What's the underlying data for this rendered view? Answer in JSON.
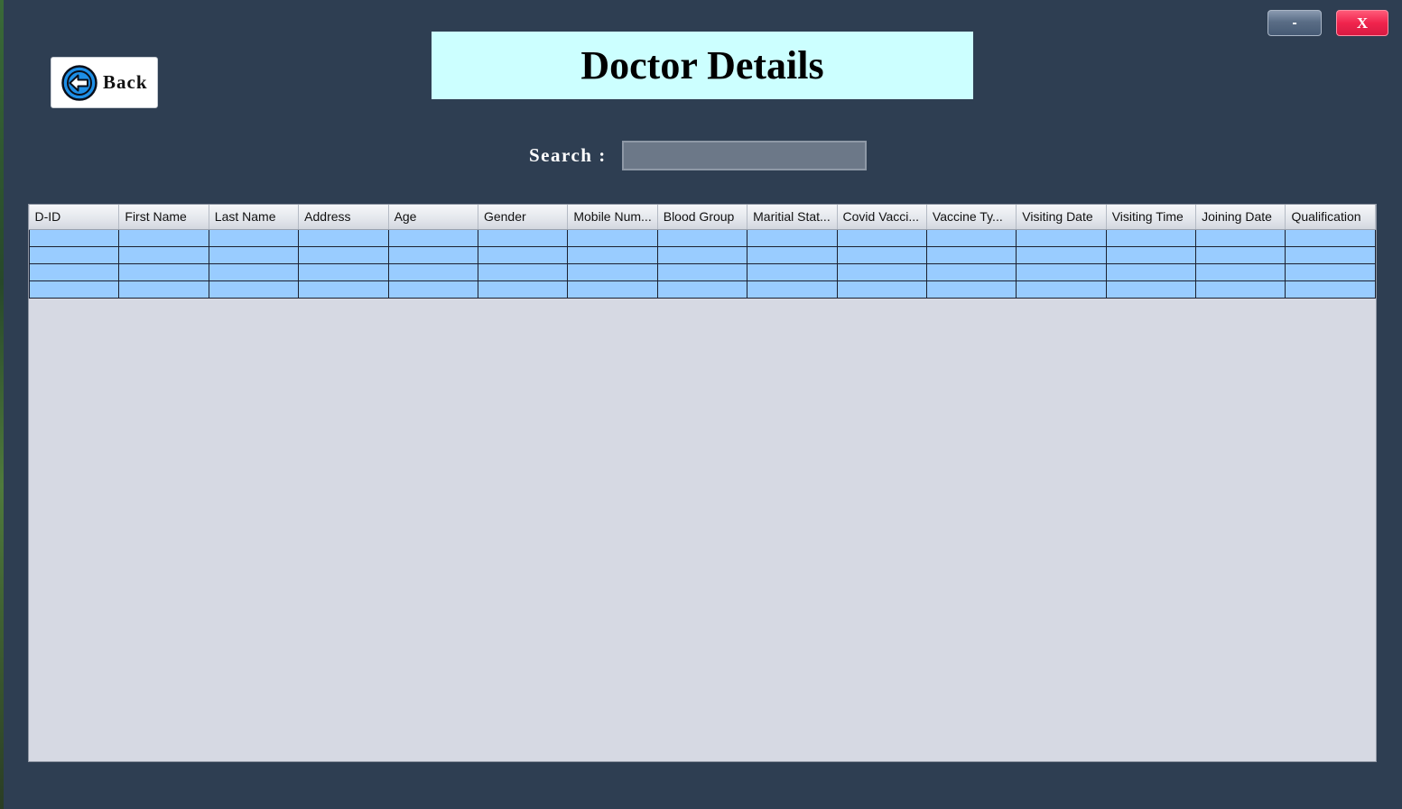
{
  "window": {
    "minimize_label": "-",
    "close_label": "X",
    "accent_background": "#2e3e52",
    "close_color": "#f0244d"
  },
  "back_button": {
    "label": "Back",
    "icon": "arrow-left-circle-icon"
  },
  "title": "Doctor Details",
  "search": {
    "label": "Search :",
    "value": "",
    "placeholder": ""
  },
  "table": {
    "columns": [
      "D-ID",
      "First Name",
      "Last Name",
      "Address",
      "Age",
      "Gender",
      "Mobile Num...",
      "Blood Group",
      "Maritial Stat...",
      "Covid Vacci...",
      "Vaccine Ty...",
      "Visiting Date",
      "Visiting Time",
      "Joining Date",
      "Qualification"
    ],
    "rows": [
      [
        "",
        "",
        "",
        "",
        "",
        "",
        "",
        "",
        "",
        "",
        "",
        "",
        "",
        "",
        ""
      ],
      [
        "",
        "",
        "",
        "",
        "",
        "",
        "",
        "",
        "",
        "",
        "",
        "",
        "",
        "",
        ""
      ],
      [
        "",
        "",
        "",
        "",
        "",
        "",
        "",
        "",
        "",
        "",
        "",
        "",
        "",
        "",
        ""
      ],
      [
        "",
        "",
        "",
        "",
        "",
        "",
        "",
        "",
        "",
        "",
        "",
        "",
        "",
        "",
        ""
      ]
    ],
    "row_color": "#99ccff"
  }
}
